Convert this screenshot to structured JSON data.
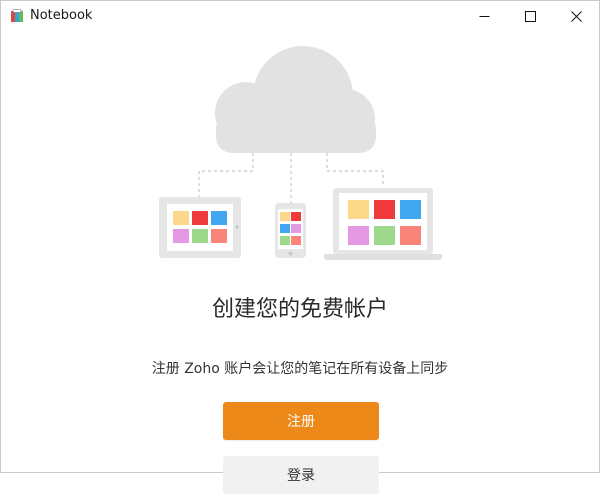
{
  "window": {
    "title": "Notebook"
  },
  "main": {
    "headline": "创建您的免费帐户",
    "subtitle": "注册 Zoho 账户会让您的笔记在所有设备上同步",
    "signup_label": "注册",
    "login_label": "登录"
  },
  "colors": {
    "accent": "#ec8919",
    "cloud": "#e2e2e2",
    "device": "#e6e6e6",
    "tiles": [
      "#fcd88a",
      "#ef3b3b",
      "#41a6f0",
      "#e39ae2",
      "#9ed88a",
      "#f8847a"
    ]
  },
  "icons": {
    "app": "notebook-icon",
    "minimize": "minimize-icon",
    "maximize": "maximize-icon",
    "close": "close-icon"
  }
}
